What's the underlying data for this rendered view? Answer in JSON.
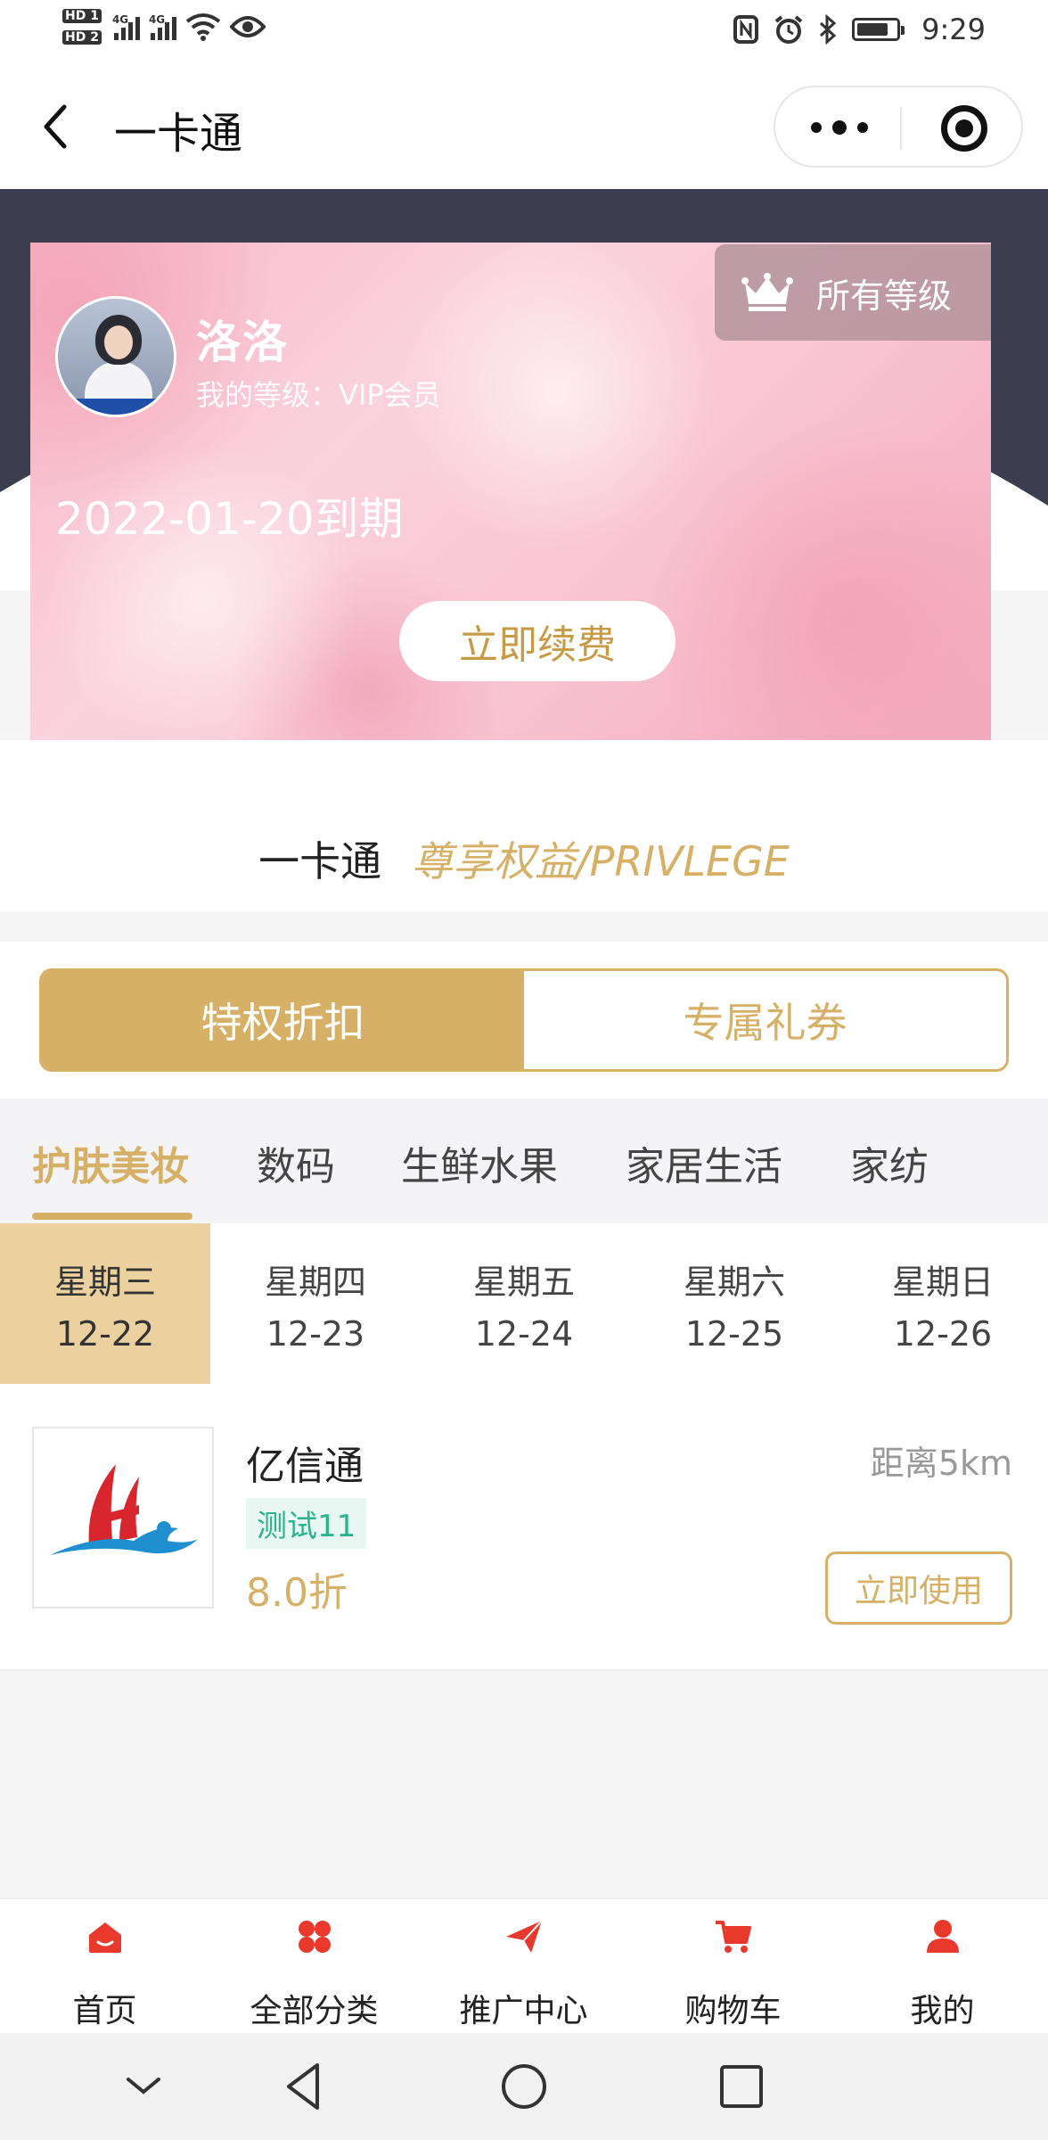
{
  "status_bar": {
    "sim1": "HD 1",
    "sim2": "HD 2",
    "net1": "4G",
    "net2": "4G",
    "time": "9:29",
    "icons": [
      "nfc-icon",
      "alarm-icon",
      "bluetooth-icon",
      "battery-icon",
      "wifi-icon",
      "eye-icon"
    ]
  },
  "nav": {
    "title": "一卡通"
  },
  "vip_card": {
    "name": "洛洛",
    "level": "我的等级：VIP会员",
    "expire": "2022-01-20到期",
    "all_levels": "所有等级",
    "renew": "立即续费"
  },
  "privilege": {
    "title_cn": "一卡通",
    "title_en": "尊享权益/PRIVLEGE"
  },
  "segments": {
    "active": "特权折扣",
    "inactive": "专属礼券"
  },
  "categories": [
    "护肤美妆",
    "数码",
    "生鲜水果",
    "家居生活",
    "家纺"
  ],
  "dates": [
    {
      "weekday": "星期三",
      "date": "12-22"
    },
    {
      "weekday": "星期四",
      "date": "12-23"
    },
    {
      "weekday": "星期五",
      "date": "12-24"
    },
    {
      "weekday": "星期六",
      "date": "12-25"
    },
    {
      "weekday": "星期日",
      "date": "12-26"
    }
  ],
  "shop": {
    "name": "亿信通",
    "tag": "测试11",
    "discount": "8.0折",
    "distance": "距离5km",
    "use": "立即使用"
  },
  "tabbar": [
    "首页",
    "全部分类",
    "推广中心",
    "购物车",
    "我的"
  ],
  "colors": {
    "gold": "#d6b067",
    "dark_band": "#3c3d4f",
    "red_icon": "#e8392c",
    "date_active": "#ecd1a0"
  }
}
